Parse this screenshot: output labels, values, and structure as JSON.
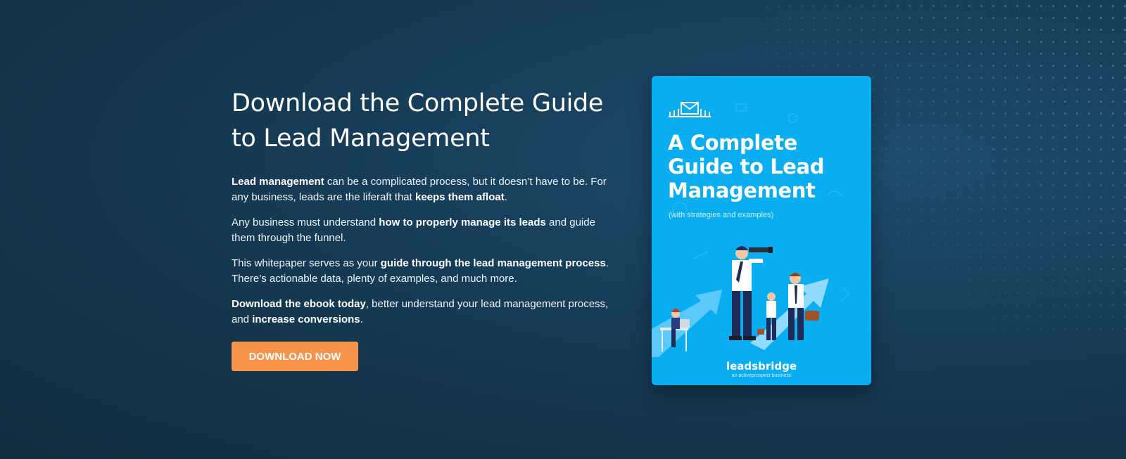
{
  "hero": {
    "headline": "Download the Complete Guide to Lead Management",
    "paragraphs": [
      [
        {
          "text": "Lead management",
          "bold": true
        },
        {
          "text": " can be a complicated process, but it doesn’t have to be. For any business, leads are the liferaft that ",
          "bold": false
        },
        {
          "text": "keeps them afloat",
          "bold": true
        },
        {
          "text": ".",
          "bold": false
        }
      ],
      [
        {
          "text": "Any business must understand ",
          "bold": false
        },
        {
          "text": "how to properly manage its leads",
          "bold": true
        },
        {
          "text": " and guide them through the funnel.",
          "bold": false
        }
      ],
      [
        {
          "text": "This whitepaper serves as your ",
          "bold": false
        },
        {
          "text": "guide through the lead management process",
          "bold": true
        },
        {
          "text": ". There’s actionable data, plenty of examples, and much more.",
          "bold": false
        }
      ],
      [
        {
          "text": "Download the ebook today",
          "bold": true
        },
        {
          "text": ", better understand your lead management process, and ",
          "bold": false
        },
        {
          "text": "increase conversions",
          "bold": true
        },
        {
          "text": ".",
          "bold": false
        }
      ]
    ],
    "cta_label": "DOWNLOAD NOW"
  },
  "ebook_cover": {
    "title": "A Complete Guide to Lead Management",
    "subtitle": "(with strategies and examples)",
    "brand": "leadsbridge",
    "brand_tagline": "an activeprospect business",
    "icon": "envelope-bridge-icon"
  },
  "colors": {
    "background": "#163a54",
    "cta": "#f7934a",
    "cover": "#0aadf0",
    "text": "#ffffff"
  }
}
